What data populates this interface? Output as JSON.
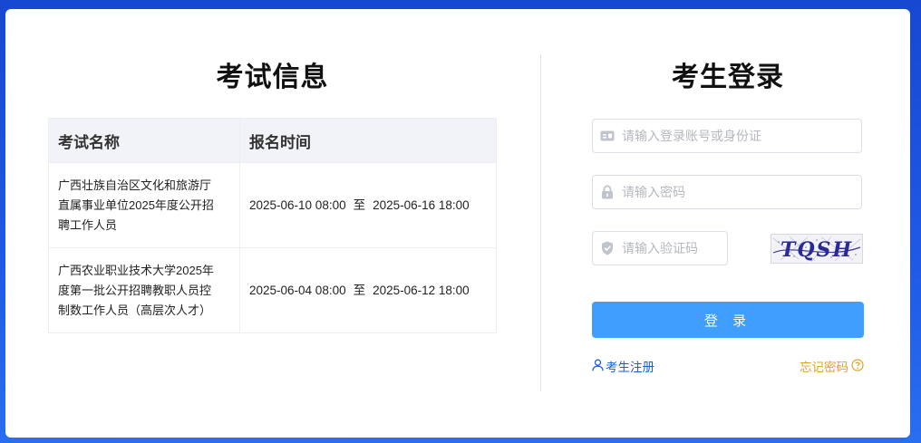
{
  "exam_info": {
    "title": "考试信息",
    "columns": [
      "考试名称",
      "报名时间"
    ],
    "rows": [
      {
        "name_lines": [
          "广西壮族自治区文化和旅游厅",
          "直属事业单位2025年度公开招",
          "聘工作人员"
        ],
        "start": "2025-06-10 08:00",
        "sep": "至",
        "end": "2025-06-16 18:00"
      },
      {
        "name_lines": [
          "广西农业职业技术大学2025年",
          "度第一批公开招聘教职人员控",
          "制数工作人员（高层次人才）"
        ],
        "start": "2025-06-04 08:00",
        "sep": "至",
        "end": "2025-06-12 18:00"
      }
    ]
  },
  "login": {
    "title": "考生登录",
    "account_placeholder": "请输入登录账号或身份证",
    "password_placeholder": "请输入密码",
    "captcha_placeholder": "请输入验证码",
    "captcha_text": "TQSH",
    "submit_label": "登 录",
    "register_label": "考生注册",
    "forgot_label": "忘记密码"
  },
  "colors": {
    "background": "#1a4fd6",
    "primary_button": "#409eff",
    "link": "#1b5fd0",
    "forgot": "#e0a12c"
  },
  "icons": [
    "id-card-icon",
    "lock-icon",
    "shield-check-icon",
    "user-icon",
    "help-circle-icon"
  ]
}
